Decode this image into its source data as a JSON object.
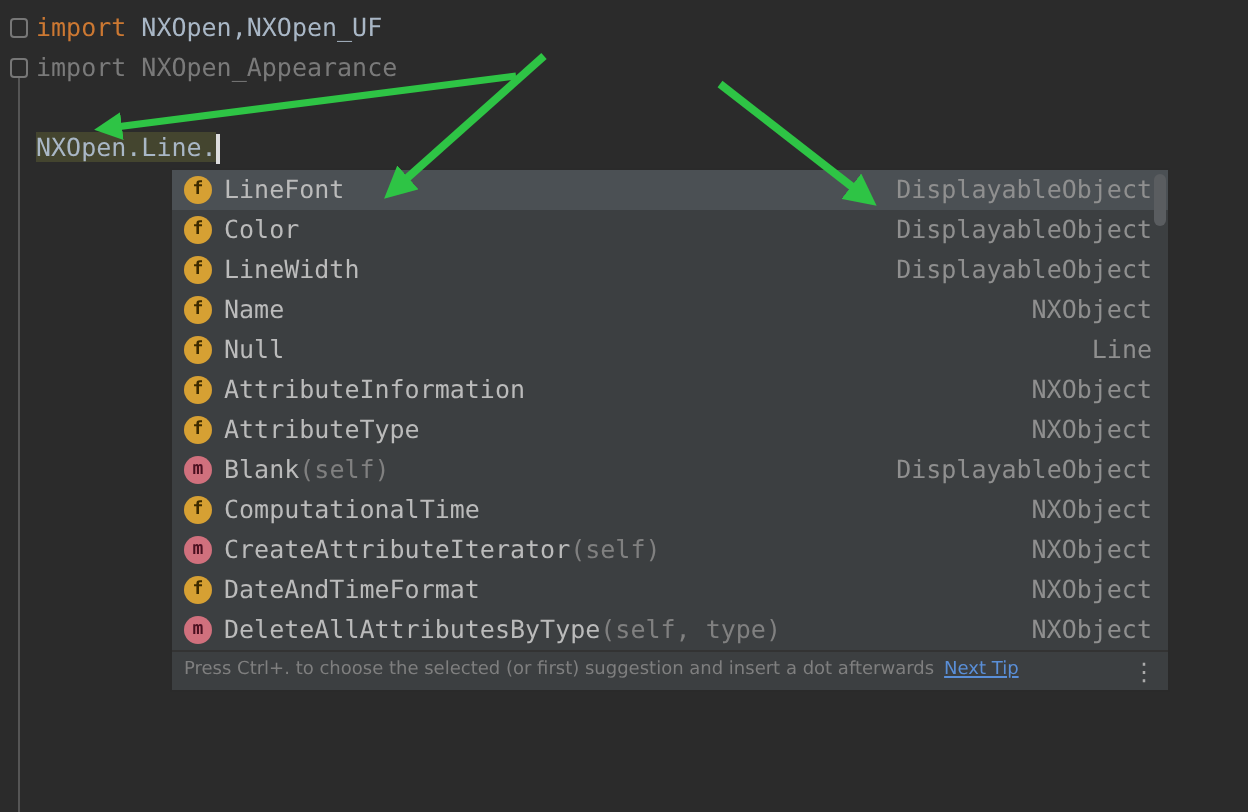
{
  "editor": {
    "lines": [
      {
        "kind": "import",
        "keyword": "import",
        "module": "NXOpen",
        "separator": ",",
        "rest": "NXOpen_UF",
        "unused": false
      },
      {
        "kind": "import",
        "keyword": "import",
        "module": "NXOpen_Appearance",
        "unused": true
      },
      {
        "kind": "blank"
      },
      {
        "kind": "expr",
        "text": "NXOpen.Line.",
        "highlighted": true
      }
    ]
  },
  "completion": {
    "items": [
      {
        "kind": "field",
        "icon": "f",
        "name": "LineFont",
        "type": "DisplayableObject",
        "selected": true
      },
      {
        "kind": "field",
        "icon": "f",
        "name": "Color",
        "type": "DisplayableObject",
        "selected": false
      },
      {
        "kind": "field",
        "icon": "f",
        "name": "LineWidth",
        "type": "DisplayableObject",
        "selected": false
      },
      {
        "kind": "field",
        "icon": "f",
        "name": "Name",
        "type": "NXObject",
        "selected": false
      },
      {
        "kind": "field",
        "icon": "f",
        "name": "Null",
        "type": "Line",
        "selected": false
      },
      {
        "kind": "field",
        "icon": "f",
        "name": "AttributeInformation",
        "type": "NXObject",
        "selected": false
      },
      {
        "kind": "field",
        "icon": "f",
        "name": "AttributeType",
        "type": "NXObject",
        "selected": false
      },
      {
        "kind": "method",
        "icon": "m",
        "name": "Blank",
        "params": "(self)",
        "type": "DisplayableObject",
        "selected": false
      },
      {
        "kind": "field",
        "icon": "f",
        "name": "ComputationalTime",
        "type": "NXObject",
        "selected": false
      },
      {
        "kind": "method",
        "icon": "m",
        "name": "CreateAttributeIterator",
        "params": "(self)",
        "type": "NXObject",
        "selected": false
      },
      {
        "kind": "field",
        "icon": "f",
        "name": "DateAndTimeFormat",
        "type": "NXObject",
        "selected": false
      },
      {
        "kind": "method",
        "icon": "m",
        "name": "DeleteAllAttributesByType",
        "params": "(self, type)",
        "type": "NXObject",
        "selected": false
      }
    ],
    "hint": "Press Ctrl+. to choose the selected (or first) suggestion and insert a dot afterwards",
    "tip_link": "Next Tip",
    "menu": "⋮"
  }
}
